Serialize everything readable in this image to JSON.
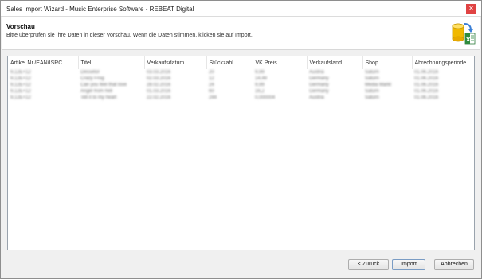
{
  "window": {
    "title": "Sales Import Wizard - Music Enterprise Software - REBEAT Digital",
    "close_glyph": "✕"
  },
  "header": {
    "heading": "Vorschau",
    "description": "Bitte überprüfen sie Ihre Daten in dieser Vorschau. Wenn die Daten stimmen, klicken sie auf Import.",
    "icon": "database-excel-import-icon"
  },
  "table": {
    "columns": [
      "Artikel Nr./EAN/ISRC",
      "Titel",
      "Verkaufsdatum",
      "Stückzahl",
      "VK Preis",
      "Verkaufsland",
      "Shop",
      "Abrechnungsperiode"
    ],
    "rows": [
      [
        "9,12E+12",
        "Dessetor",
        "03.03.2016",
        "20",
        "9,99",
        "Austria",
        "Saturn",
        "01.06.2016"
      ],
      [
        "9,12E+12",
        "Crazy Frog",
        "02.03.2016",
        "12",
        "14,49",
        "Germany",
        "Saturn",
        "01.06.2016"
      ],
      [
        "9,12E+12",
        "Can you feel that love",
        "28.02.2016",
        "24",
        "9,99",
        "Germany",
        "Media Markt",
        "01.06.2016"
      ],
      [
        "9,12E+12",
        "Angel from hell",
        "01.03.2016",
        "60",
        "16,2",
        "Germany",
        "Saturn",
        "01.06.2016"
      ],
      [
        "9,12E+12",
        "Tell it to my heart",
        "22.02.2016",
        "244",
        "0,000004",
        "Austria",
        "Saturn",
        "01.06.2016"
      ]
    ]
  },
  "buttons": {
    "back_label": "< Zurück",
    "import_label": "Import",
    "cancel_label": "Abbrechen"
  }
}
